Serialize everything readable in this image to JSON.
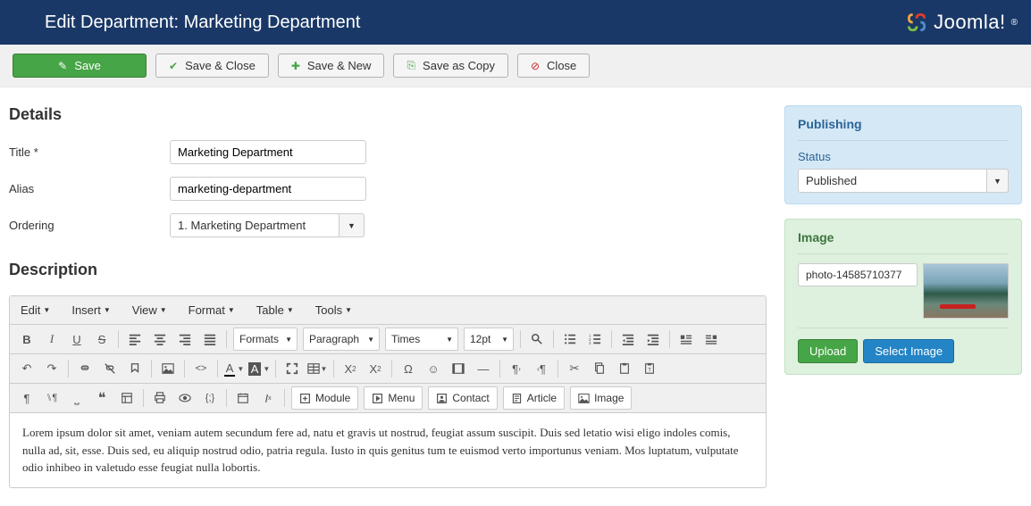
{
  "header": {
    "title": "Edit Department: Marketing Department",
    "logo": "Joomla!"
  },
  "toolbar": {
    "save": "Save",
    "save_close": "Save & Close",
    "save_new": "Save & New",
    "save_copy": "Save as Copy",
    "close": "Close"
  },
  "details": {
    "heading": "Details",
    "title_label": "Title *",
    "title_value": "Marketing Department",
    "alias_label": "Alias",
    "alias_value": "marketing-department",
    "ordering_label": "Ordering",
    "ordering_value": "1. Marketing Department"
  },
  "description": {
    "heading": "Description",
    "menus": {
      "edit": "Edit",
      "insert": "Insert",
      "view": "View",
      "format": "Format",
      "table": "Table",
      "tools": "Tools"
    },
    "selects": {
      "formats": "Formats",
      "paragraph": "Paragraph",
      "font": "Times",
      "size": "12pt"
    },
    "mods": {
      "module": "Module",
      "menu": "Menu",
      "contact": "Contact",
      "article": "Article",
      "image": "Image"
    },
    "content": "Lorem ipsum dolor sit amet, veniam autem secundum fere ad, natu et gravis ut nostrud, feugiat assum suscipit. Duis sed letatio wisi eligo indoles comis, nulla ad, sit, esse. Duis sed, eu aliquip nostrud odio, patria regula. Iusto in quis genitus tum te euismod verto importunus veniam. Mos luptatum, vulputate odio inhibeo in valetudo esse feugiat nulla lobortis."
  },
  "publishing": {
    "heading": "Publishing",
    "status_label": "Status",
    "status_value": "Published"
  },
  "image": {
    "heading": "Image",
    "value": "photo-14585710377",
    "upload": "Upload",
    "select": "Select Image"
  }
}
